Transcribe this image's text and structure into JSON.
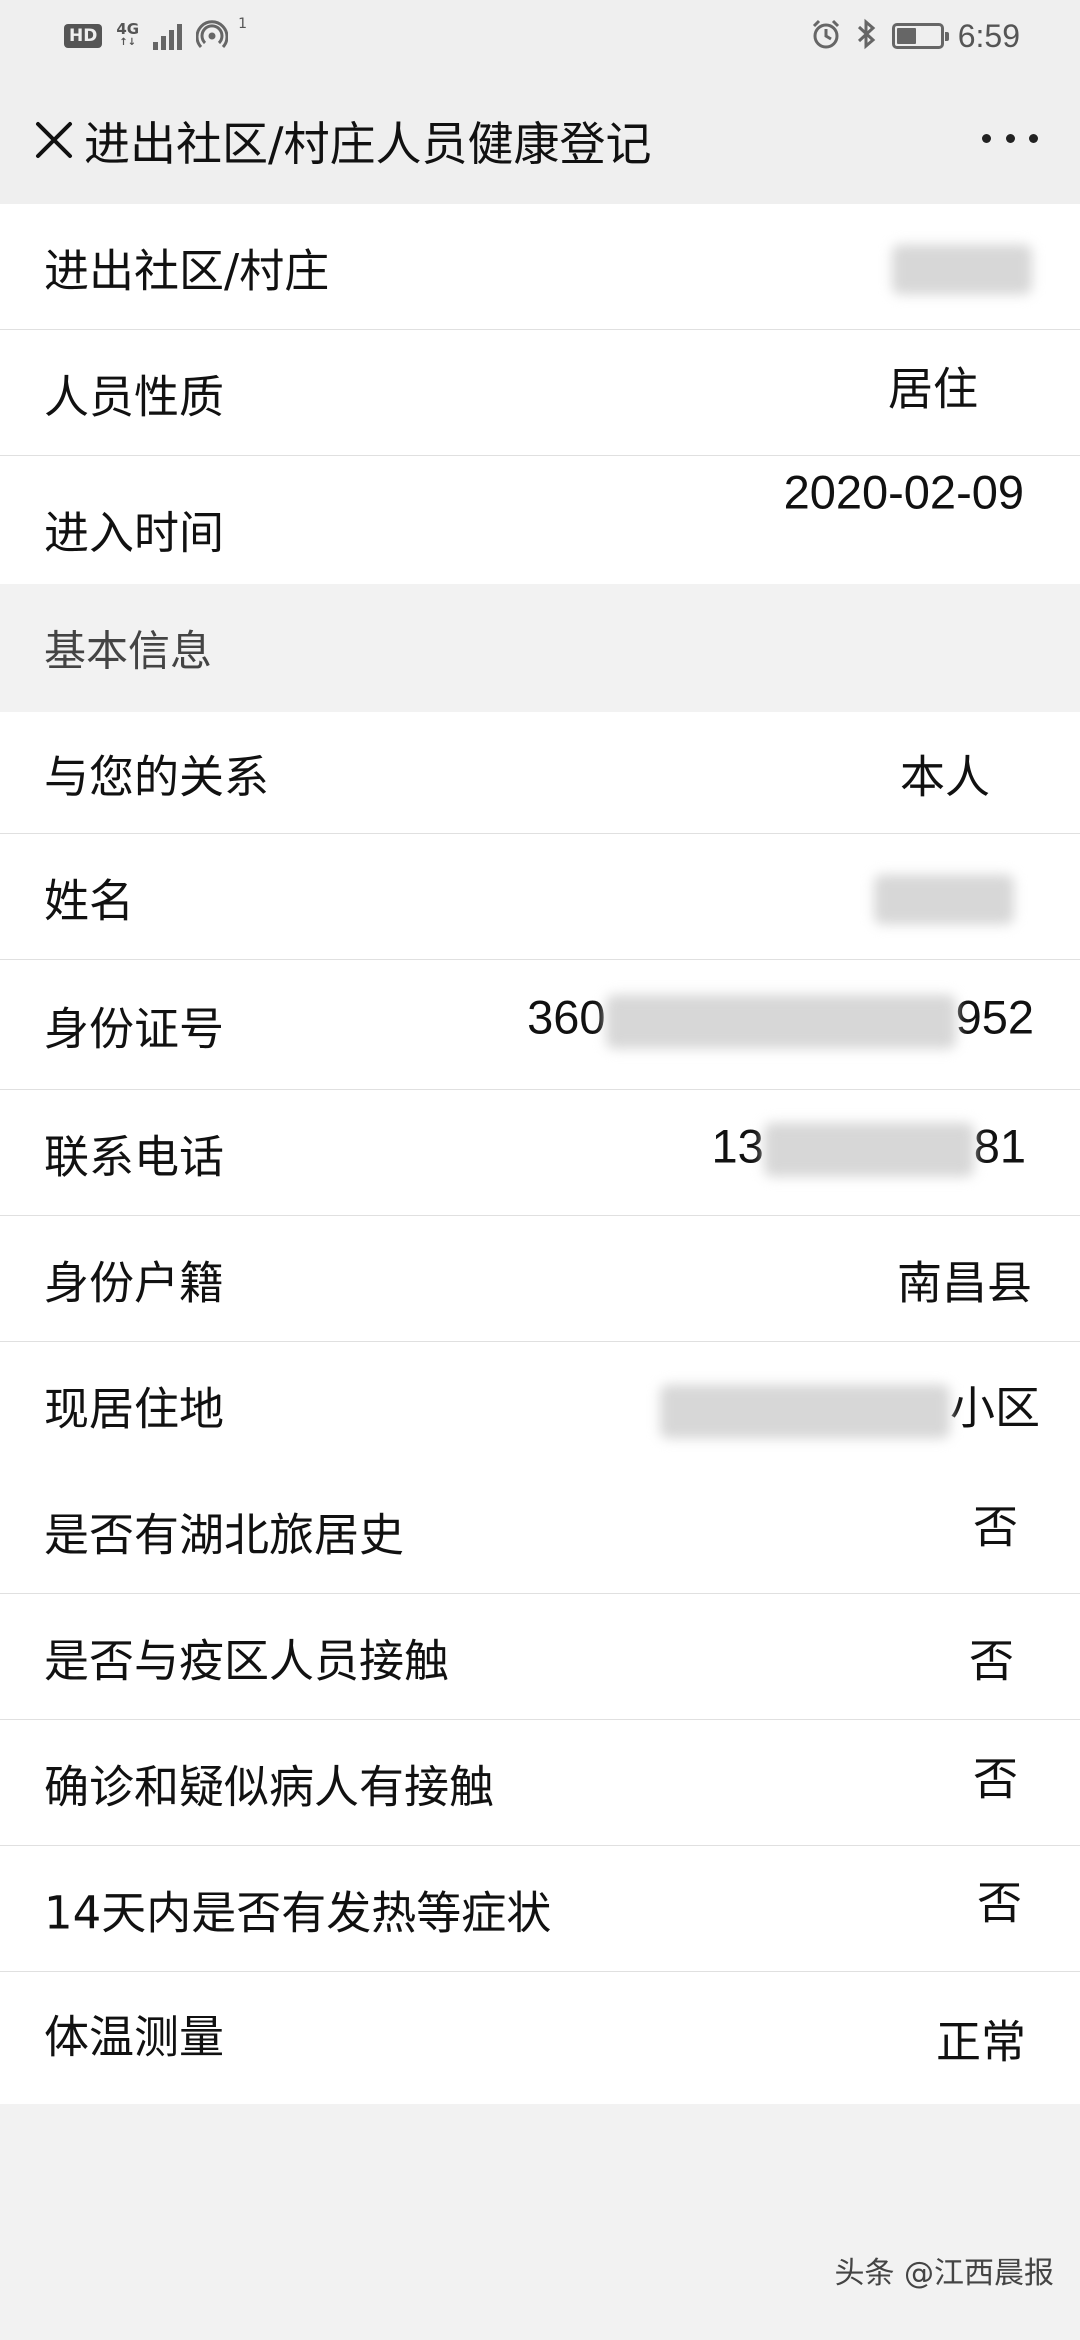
{
  "status_bar": {
    "hd_label": "HD",
    "network_label": "4G",
    "network_sub": "↑↓",
    "hotspot_count": "1",
    "time": "6:59",
    "battery_level_pct": 45,
    "icons": [
      "hd-icon",
      "signal-icon",
      "hotspot-icon",
      "alarm-icon",
      "bluetooth-icon",
      "battery-icon"
    ]
  },
  "nav": {
    "title": "进出社区/村庄人员健康登记",
    "close_icon": "close-icon",
    "more_icon": "more-dots-icon"
  },
  "section1": {
    "rows": [
      {
        "label": "进出社区/村庄",
        "value": ""
      },
      {
        "label": "人员性质",
        "value": "居住"
      },
      {
        "label": "进入时间",
        "value": "2020-02-09"
      }
    ]
  },
  "group_header": "基本信息",
  "section2": {
    "rows": [
      {
        "label": "与您的关系",
        "value": "本人"
      },
      {
        "label": "姓名",
        "value": ""
      },
      {
        "label": "身份证号",
        "value_prefix": "360",
        "value_suffix": "952"
      },
      {
        "label": "联系电话",
        "value_prefix": "13",
        "value_suffix": "81"
      },
      {
        "label": "身份户籍",
        "value": "南昌县"
      },
      {
        "label": "现居住地",
        "value_suffix": "小区"
      },
      {
        "label": "是否有湖北旅居史",
        "value": "否"
      },
      {
        "label": "是否与疫区人员接触",
        "value": "否"
      },
      {
        "label": "确诊和疑似病人有接触",
        "value": "否"
      },
      {
        "label": "14天内是否有发热等症状",
        "value": "否"
      },
      {
        "label": "体温测量",
        "value": "正常"
      }
    ]
  },
  "watermark": "头条 @江西晨报",
  "colors": {
    "page_bg": "#f2f2f2",
    "card_bg": "#ffffff",
    "divider": "#e0e0e0",
    "text": "#111111"
  }
}
